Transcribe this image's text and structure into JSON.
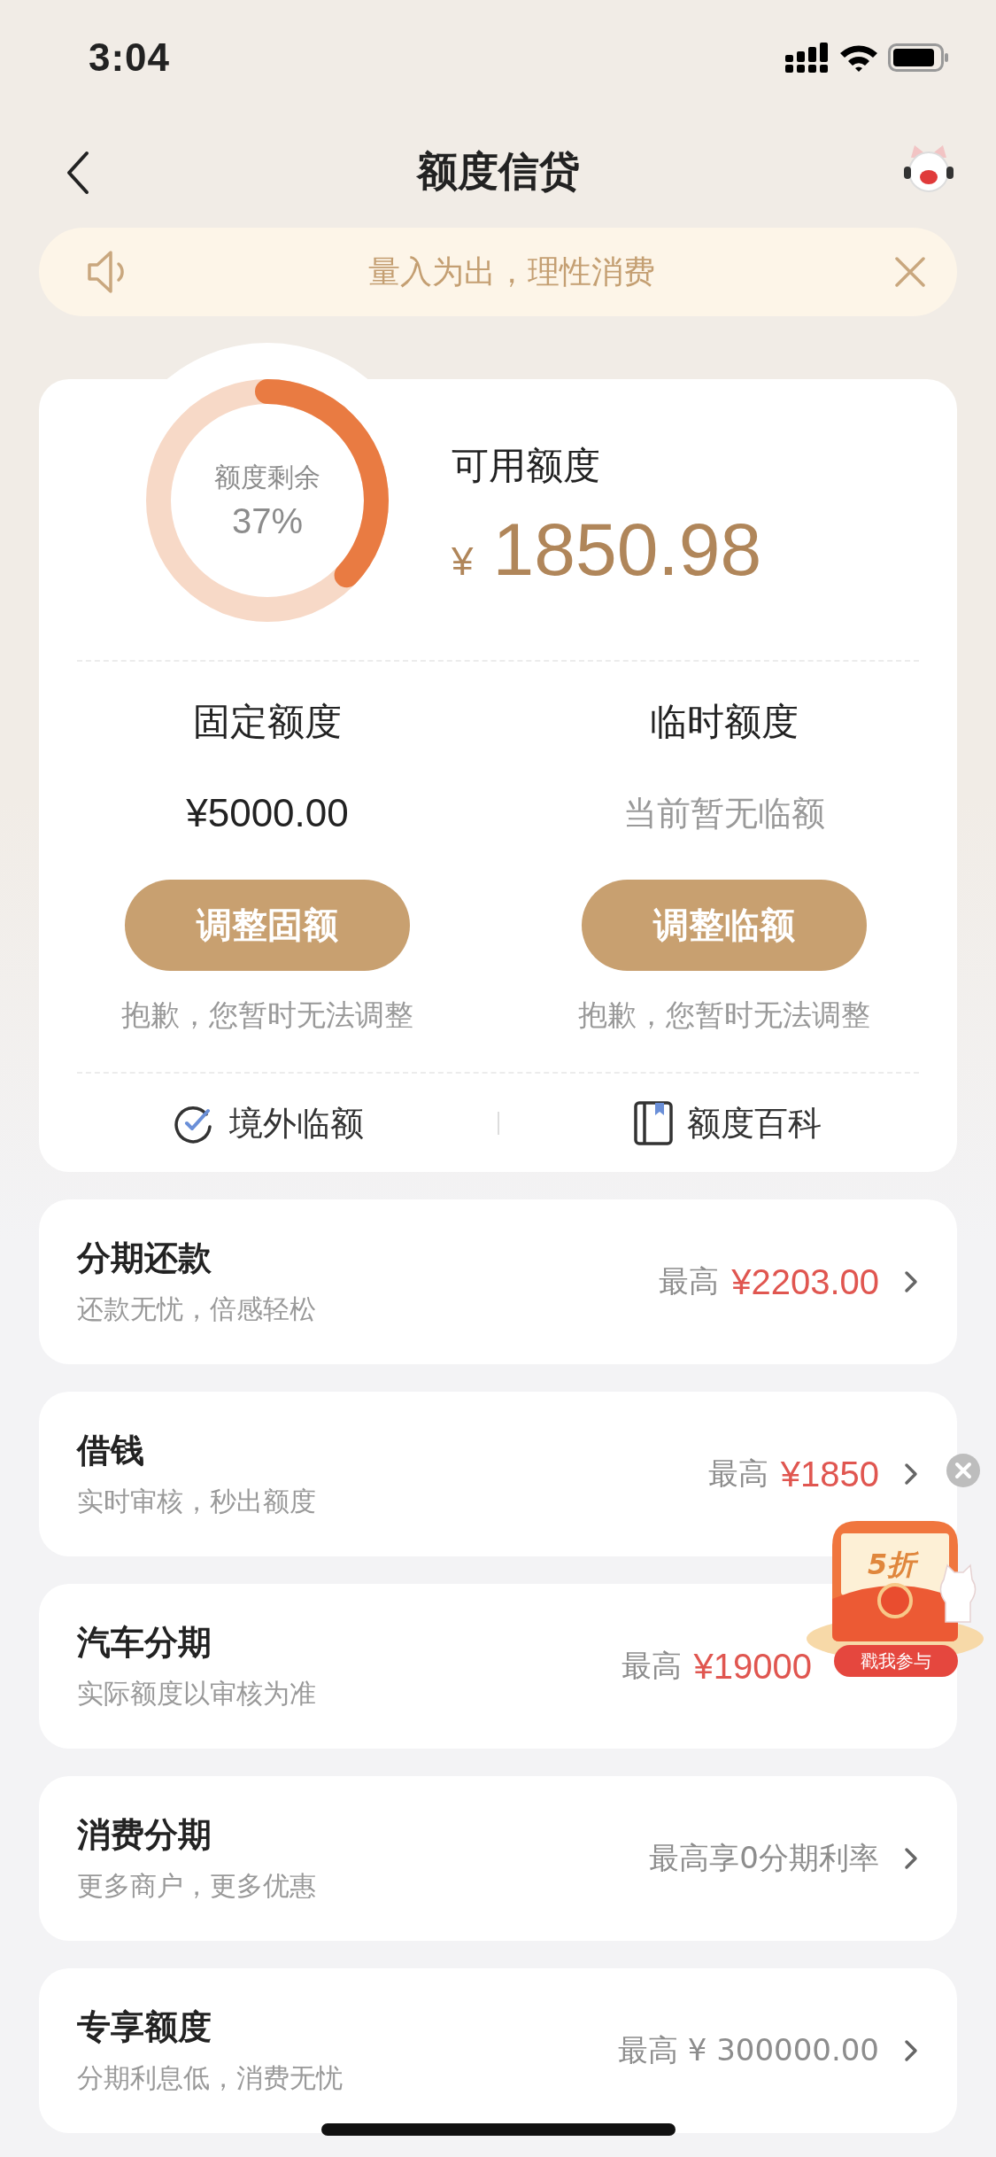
{
  "status_bar": {
    "time": "3:04"
  },
  "nav": {
    "title": "额度信贷"
  },
  "notice": {
    "text": "量入为出，理性消费"
  },
  "credit": {
    "ring_label": "额度剩余",
    "ring_value": "37%",
    "level": 0.37,
    "available_label": "可用额度",
    "currency": "¥",
    "available_amount": "1850.98"
  },
  "limits": [
    {
      "title": "固定额度",
      "value": "¥5000.00",
      "kind": "amount",
      "button": "调整固额",
      "note": "抱歉，您暂时无法调整"
    },
    {
      "title": "临时额度",
      "value": "当前暂无临额",
      "kind": "empty",
      "button": "调整临额",
      "note": "抱歉，您暂时无法调整"
    }
  ],
  "links": [
    {
      "label": "境外临额"
    },
    {
      "label": "额度百科"
    }
  ],
  "products": [
    {
      "title": "分期还款",
      "subtitle": "还款无忧，倍感轻松",
      "prefix": "最高",
      "amount": "¥2203.00",
      "chevron": true
    },
    {
      "title": "借钱",
      "subtitle": "实时审核，秒出额度",
      "prefix": "最高",
      "amount": "¥1850",
      "chevron": true
    },
    {
      "title": "汽车分期",
      "subtitle": "实际额度以审核为准",
      "prefix": "最高",
      "amount": "¥19000",
      "chevron": false
    },
    {
      "title": "消费分期",
      "subtitle": "更多商户，更多优惠",
      "prefix": "最高享0分期利率",
      "chevron": true
    },
    {
      "title": "专享额度",
      "subtitle": "分期利息低，消费无忧",
      "prefix": "最高 ¥ 300000.00",
      "chevron": true
    }
  ],
  "promo": {
    "badge": "5折",
    "action": "戳我参与"
  }
}
